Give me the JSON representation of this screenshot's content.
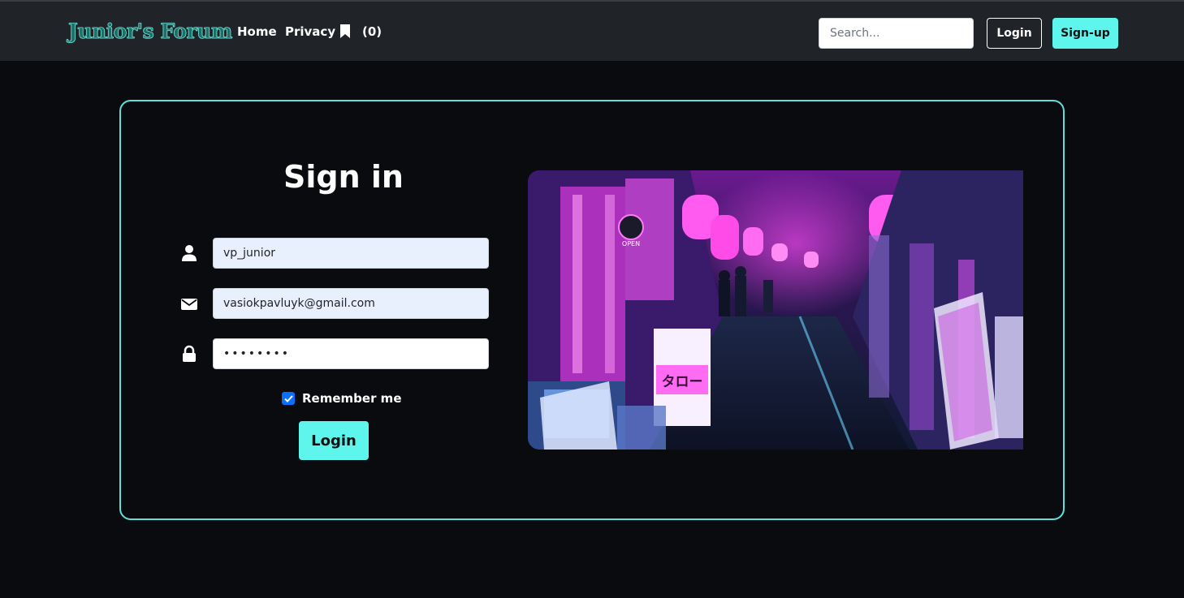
{
  "navbar": {
    "brand": "Junior's Forum",
    "links": [
      {
        "label": "Home"
      },
      {
        "label": "Privacy"
      }
    ],
    "bookmark_icon": "bookmark-icon",
    "bookmark_count": "(0)",
    "search_placeholder": "Search...",
    "login_label": "Login",
    "signup_label": "Sign-up"
  },
  "form": {
    "title": "Sign in",
    "username_value": "vp_junior",
    "email_value": "vasiokpavluyk@gmail.com",
    "password_value": "••••••••",
    "remember_label": "Remember me",
    "remember_checked": true,
    "submit_label": "Login",
    "icons": [
      "user-icon",
      "envelope-icon",
      "lock-icon"
    ]
  },
  "hero": {
    "sign_text": "タロー",
    "open_sign": "OPEN"
  },
  "colors": {
    "accent": "#5ef5ec",
    "navbar_bg": "#202327",
    "page_bg": "#0a0b0e",
    "card_border": "#5ee0d8",
    "autofill_bg": "#e8f0fe",
    "checkbox": "#0d6efd"
  }
}
